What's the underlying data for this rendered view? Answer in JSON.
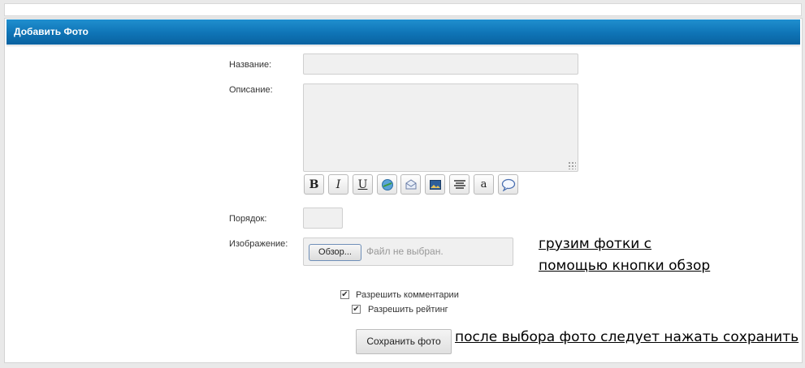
{
  "panel": {
    "title": "Добавить Фото"
  },
  "form": {
    "name_label": "Название:",
    "name_value": "",
    "description_label": "Описание:",
    "description_value": "",
    "toolbar": {
      "buttons": [
        {
          "icon": "bold-icon",
          "glyph": "B"
        },
        {
          "icon": "italic-icon",
          "glyph": "I"
        },
        {
          "icon": "underline-icon",
          "glyph": "U"
        },
        {
          "icon": "link-icon",
          "glyph": ""
        },
        {
          "icon": "email-icon",
          "glyph": ""
        },
        {
          "icon": "image-icon",
          "glyph": ""
        },
        {
          "icon": "align-center-icon",
          "glyph": ""
        },
        {
          "icon": "font-icon",
          "glyph": "a"
        },
        {
          "icon": "quote-icon",
          "glyph": ""
        }
      ]
    },
    "order_label": "Порядок:",
    "order_value": "",
    "image_label": "Изображение:",
    "browse_label": "Обзор...",
    "file_status": "Файл не выбран.",
    "allow_comments_label": "Разрешить комментарии",
    "allow_comments_checked": true,
    "allow_rating_label": "Разрешить рейтинг",
    "allow_rating_checked": true,
    "save_label": "Сохранить фото"
  },
  "annotations": {
    "upload_line1": "грузим фотки с ",
    "upload_line2": "помощью кнопки обзор",
    "save_hint": "после выбора фото следует нажать сохранить"
  },
  "colors": {
    "header_bg": "#0f74b6",
    "field_bg": "#f0f0f0"
  }
}
